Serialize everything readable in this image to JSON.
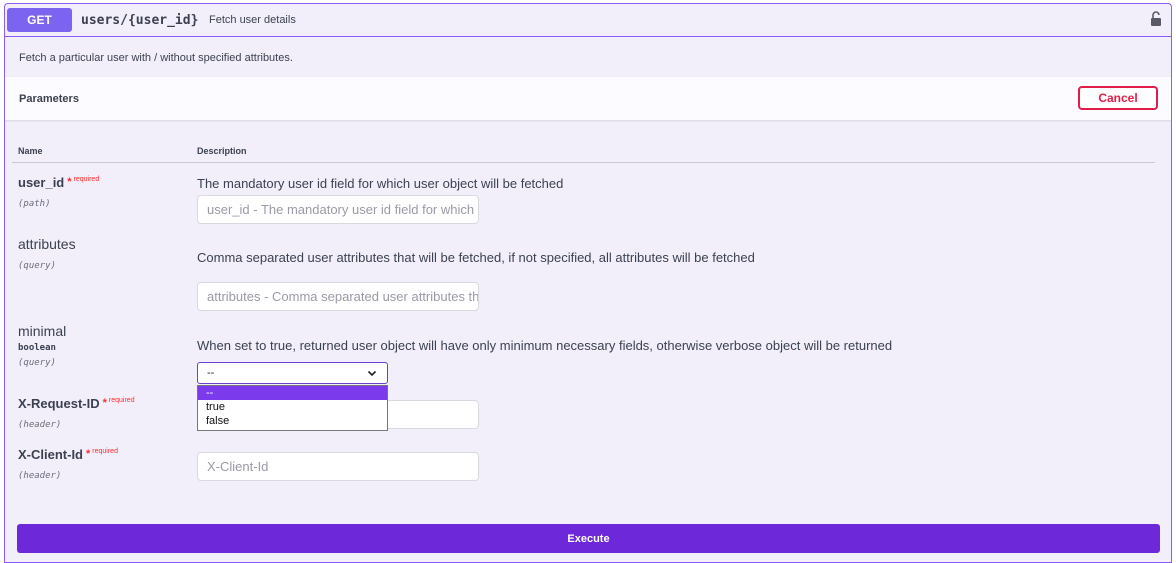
{
  "summary": {
    "method": "GET",
    "path": "users/{user_id}",
    "description": "Fetch user details"
  },
  "description": "Fetch a particular user with / without specified attributes.",
  "parameters": {
    "title": "Parameters",
    "cancel_label": "Cancel",
    "col_name": "Name",
    "col_description": "Description",
    "required_label": "required",
    "items": [
      {
        "name": "user_id",
        "required": true,
        "in": "(path)",
        "description": "The mandatory user id field for which user object will be fetched",
        "placeholder": "user_id - The mandatory user id field for which user object will be fetched",
        "value": ""
      },
      {
        "name": "attributes",
        "required": false,
        "in": "(query)",
        "description": "Comma separated user attributes that will be fetched, if not specified, all attributes will be fetched",
        "placeholder": "attributes - Comma separated user attributes that will be fetched",
        "value": ""
      },
      {
        "name": "minimal",
        "required": false,
        "type": "boolean",
        "in": "(query)",
        "description": "When set to true, returned user object will have only minimum necessary fields, otherwise verbose object will be returned",
        "selected": "--",
        "options": [
          "--",
          "true",
          "false"
        ]
      },
      {
        "name": "X-Request-ID",
        "required": true,
        "in": "(header)",
        "placeholder": "X-Request-ID",
        "value": ""
      },
      {
        "name": "X-Client-Id",
        "required": true,
        "in": "(header)",
        "placeholder": "X-Client-Id",
        "value": ""
      }
    ]
  },
  "execute_label": "Execute",
  "colors": {
    "accent": "#6d28d9",
    "method_badge": "#7c63f0",
    "cancel": "#e11d48",
    "required": "#ff2d2d"
  },
  "icons": {
    "lock": "unlocked-padlock-icon",
    "select": "chevron-down-icon"
  }
}
